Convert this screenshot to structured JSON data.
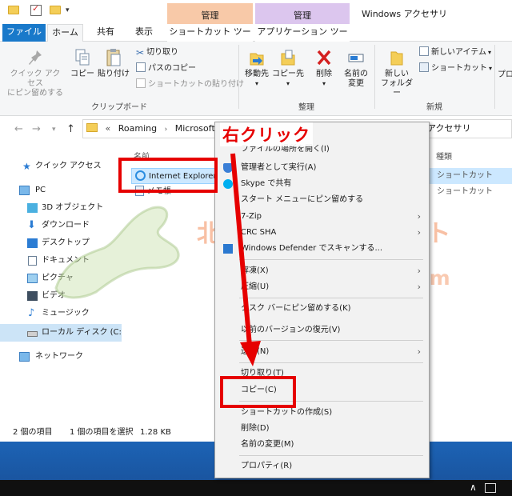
{
  "titlebar": {
    "title": "Windows アクセサリ",
    "ctx_tab_1": "管理",
    "ctx_tab_2": "管理"
  },
  "tabs": {
    "file": "ファイル",
    "home": "ホーム",
    "share": "共有",
    "view": "表示",
    "shortcut_tools": "ショートカット ツール",
    "app_tools": "アプリケーション ツール"
  },
  "ribbon": {
    "pin_quick_line1": "クイック アクセス",
    "pin_quick_line2": "にピン留めする",
    "copy": "コピー",
    "paste": "貼り付け",
    "cut": "切り取り",
    "copy_path": "パスのコピー",
    "paste_shortcut": "ショートカットの貼り付け",
    "clipboard_group": "クリップボード",
    "move_to": "移動先",
    "copy_to": "コピー先",
    "delete": "削除",
    "rename_line1": "名前の",
    "rename_line2": "変更",
    "organize_group": "整理",
    "new_folder_line1": "新しい",
    "new_folder_line2": "フォルダー",
    "new_item": "新しいアイテム",
    "shortcut": "ショートカット",
    "new_group": "新規",
    "properties_partial": "プロ"
  },
  "address": {
    "prefix": "«",
    "crumbs": [
      "Roaming",
      "Microsoft"
    ],
    "tail": "アクセサリ"
  },
  "nav": {
    "items": [
      {
        "label": "クイック アクセス"
      },
      {
        "label": "PC"
      },
      {
        "label": "3D オブジェクト"
      },
      {
        "label": "ダウンロード"
      },
      {
        "label": "デスクトップ"
      },
      {
        "label": "ドキュメント"
      },
      {
        "label": "ピクチャ"
      },
      {
        "label": "ビデオ"
      },
      {
        "label": "ミュージック"
      },
      {
        "label": "ローカル ディスク (C:)"
      },
      {
        "label": "ネットワーク"
      }
    ]
  },
  "files": {
    "col_name": "名前",
    "col_type": "種類",
    "rows": [
      {
        "name": "Internet Explorer",
        "type": "ショートカット"
      },
      {
        "name": "メモ帳",
        "type": "ショートカット"
      }
    ]
  },
  "status": {
    "count": "2 個の項目",
    "selection": "1 個の項目を選択",
    "size": "1.28 KB"
  },
  "context_menu": {
    "items": [
      "ファイルの場所を開く(I)",
      "管理者として実行(A)",
      "Skype で共有",
      "スタート メニューにピン留めする",
      "7-Zip",
      "CRC SHA",
      "Windows Defender でスキャンする...",
      "解凍(X)",
      "圧縮(U)",
      "タスク バーにピン留めする(K)",
      "以前のバージョンの復元(V)",
      "送る(N)",
      "切り取り(T)",
      "コピー(C)",
      "ショートカットの作成(S)",
      "削除(D)",
      "名前の変更(M)",
      "プロパティ(R)"
    ]
  },
  "annotation": {
    "right_click": "右クリック"
  },
  "watermark": {
    "text": "北陸くるま情報サイト",
    "url": "hokurikucar.com"
  },
  "colors": {
    "accent": "#1979ca",
    "annotation_red": "#e60000",
    "ctx_tab_orange": "#f8c9a8",
    "ctx_tab_purple": "#dcc6ee",
    "selection": "#cce8ff"
  }
}
